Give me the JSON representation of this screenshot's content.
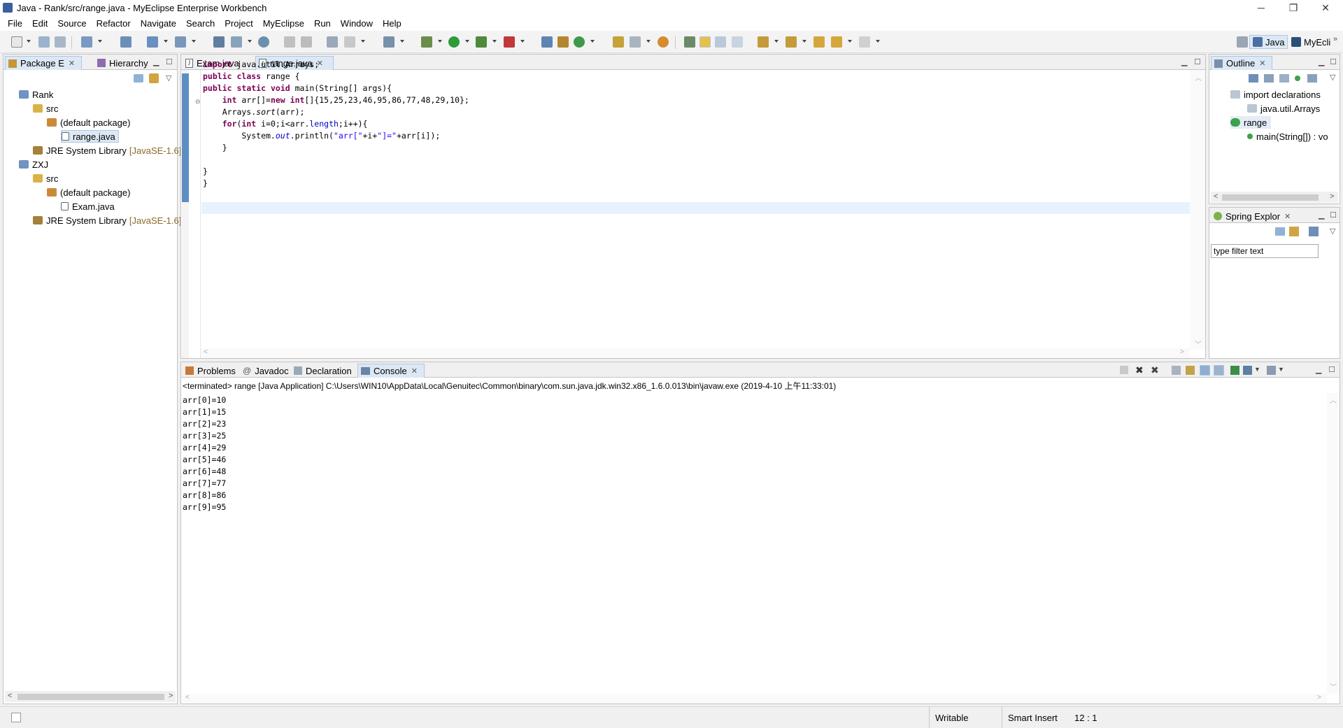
{
  "window": {
    "title": "Java - Rank/src/range.java - MyEclipse Enterprise Workbench",
    "minimize": "─",
    "maximize": "❐",
    "close": "✕"
  },
  "menu": [
    "File",
    "Edit",
    "Source",
    "Refactor",
    "Navigate",
    "Search",
    "Project",
    "MyEclipse",
    "Run",
    "Window",
    "Help"
  ],
  "perspectives": {
    "java": "Java",
    "myeclipse": "MyEcli",
    "more": "»"
  },
  "package_explorer": {
    "tabs": [
      "Package E",
      "Hierarchy"
    ],
    "tree": [
      {
        "label": "Rank",
        "level": 0,
        "icon": "project-icon"
      },
      {
        "label": "src",
        "level": 1,
        "icon": "source-folder-icon"
      },
      {
        "label": "(default package)",
        "level": 2,
        "icon": "package-icon"
      },
      {
        "label": "range.java",
        "level": 3,
        "icon": "java-file-icon",
        "selected": true
      },
      {
        "label": "JRE System Library",
        "suffix": "[JavaSE-1.6]",
        "level": 1,
        "icon": "library-icon"
      },
      {
        "label": "ZXJ",
        "level": 0,
        "icon": "project-icon"
      },
      {
        "label": "src",
        "level": 1,
        "icon": "source-folder-icon"
      },
      {
        "label": "(default package)",
        "level": 2,
        "icon": "package-icon"
      },
      {
        "label": "Exam.java",
        "level": 3,
        "icon": "java-file-icon"
      },
      {
        "label": "JRE System Library",
        "suffix": "[JavaSE-1.6]",
        "level": 1,
        "icon": "library-icon"
      }
    ]
  },
  "editor": {
    "tabs": [
      {
        "label": "Exam.java",
        "active": false
      },
      {
        "label": "range.java",
        "active": true
      }
    ],
    "code": [
      "import java.util.Arrays;",
      "public class range {",
      "public static void main(String[] args){",
      "    int arr[]=new int[]{15,25,23,46,95,86,77,48,29,10};",
      "    Arrays.sort(arr);",
      "    for(int i=0;i<arr.length;i++){",
      "        System.out.println(\"arr[\"+i+\"]=\"+arr[i]);",
      "    }",
      "",
      "}",
      "}"
    ]
  },
  "outline": {
    "tab": "Outline",
    "items": [
      {
        "label": "import declarations",
        "level": 0
      },
      {
        "label": "java.util.Arrays",
        "level": 1
      },
      {
        "label": "range",
        "level": 0,
        "selected": true
      },
      {
        "label": "main(String[]) : vo",
        "level": 1
      }
    ]
  },
  "spring_explorer": {
    "tab": "Spring Explor",
    "filter_placeholder": "type filter text"
  },
  "bottom_panel": {
    "tabs": [
      "Problems",
      "Javadoc",
      "Declaration",
      "Console"
    ],
    "active_tab": "Console",
    "console_header": "<terminated> range [Java Application] C:\\Users\\WIN10\\AppData\\Local\\Genuitec\\Common\\binary\\com.sun.java.jdk.win32.x86_1.6.0.013\\bin\\javaw.exe (2019-4-10 上午11:33:01)",
    "console_output": [
      "arr[0]=10",
      "arr[1]=15",
      "arr[2]=23",
      "arr[3]=25",
      "arr[4]=29",
      "arr[5]=46",
      "arr[6]=48",
      "arr[7]=77",
      "arr[8]=86",
      "arr[9]=95"
    ]
  },
  "status": {
    "writable": "Writable",
    "insert_mode": "Smart Insert",
    "position": "12 : 1"
  },
  "colors": {
    "keyword": "#7f0055",
    "string": "#2a00ff",
    "field": "#0000c0",
    "current_line": "#e8f2fe",
    "selection": "#dde8f5"
  }
}
